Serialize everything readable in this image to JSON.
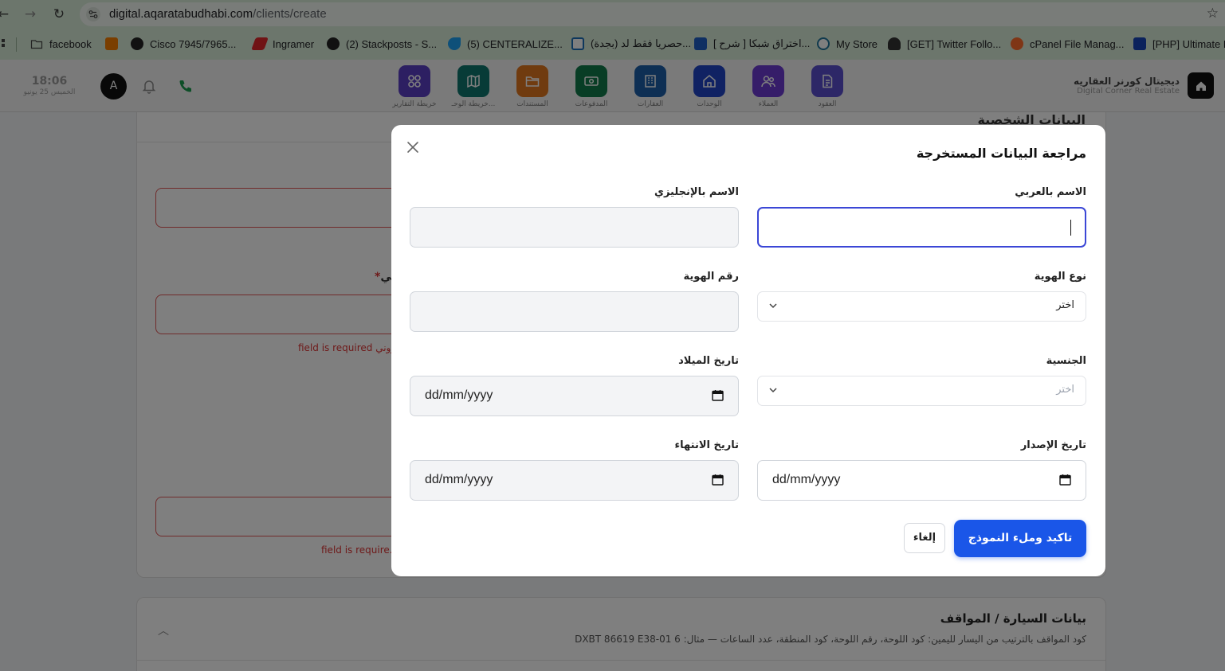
{
  "browser": {
    "url_host": "digital.aqaratabudhabi.com",
    "url_path": "/clients/create",
    "bookmarks": [
      {
        "label": "facebook",
        "icon": "folder-icon"
      },
      {
        "label": "",
        "icon": "blogger-icon"
      },
      {
        "label": "Cisco 7945/7965...",
        "icon": "globe-icon"
      },
      {
        "label": "Ingramer",
        "icon": "ingramer-icon"
      },
      {
        "label": "(2) Stackposts - S...",
        "icon": "globe-icon"
      },
      {
        "label": "(5) CENTERALIZE...",
        "icon": "bird-icon"
      },
      {
        "label": "(بجدة) حصريا فقط لد...",
        "icon": "site-icon"
      },
      {
        "label": "[ شرح ] اختراق شبكا...",
        "icon": "site-icon"
      },
      {
        "label": "My Store",
        "icon": "wordpress-icon"
      },
      {
        "label": "[GET] Twitter Follo...",
        "icon": "user-icon"
      },
      {
        "label": "cPanel File Manag...",
        "icon": "cpanel-icon"
      },
      {
        "label": "[PHP] Ultimate F",
        "icon": "s-icon"
      }
    ]
  },
  "header": {
    "time": "18:06",
    "date": "الخميس 25 يونيو",
    "avatar_letter": "A",
    "brand_ar": "ديجيتال كورنر العقاريه",
    "brand_en": "Digital Corner Real Estate",
    "modules": [
      {
        "label": "خريطة التقارير",
        "color": "#5b3fc4",
        "icon": "grid-icon"
      },
      {
        "label": "خريطة الوحـ...",
        "color": "#0f766e",
        "icon": "map-icon"
      },
      {
        "label": "المستندات",
        "color": "#e0761e",
        "icon": "folder-icon"
      },
      {
        "label": "المدفوعات",
        "color": "#107a4a",
        "icon": "money-icon"
      },
      {
        "label": "العقارات",
        "color": "#1d5fa8",
        "icon": "building-icon"
      },
      {
        "label": "الوحدات",
        "color": "#2145c7",
        "icon": "home-icon"
      },
      {
        "label": "العملاء",
        "color": "#6d3bd2",
        "icon": "users-icon"
      },
      {
        "label": "العقود",
        "color": "#5a4fcf",
        "icon": "document-icon"
      }
    ]
  },
  "background_page": {
    "section_title": "البيانات الشخصية",
    "label_fragment": "ني",
    "error_1": "field is required رّوني.",
    "error_2": "field is require.",
    "car_section_title": "بيانات السيارة / المواقف",
    "car_section_hint": "كود المواقف بالترتيب من اليسار لليمين: كود اللوحة، رقم اللوحة، كود المنطقة، عدد الساعات — مثال: DXBT 86619 E38-01 6"
  },
  "modal": {
    "title": "مراجعة البيانات المستخرجة",
    "fields": {
      "name_ar_label": "الاسم بالعربي",
      "name_ar_value": "",
      "name_en_label": "الاسم بالإنجليزي",
      "name_en_value": "",
      "id_type_label": "نوع الهوية",
      "id_type_value": "اختر",
      "id_number_label": "رقم الهوية",
      "id_number_value": "",
      "nationality_label": "الجنسية",
      "nationality_value": "اختر",
      "birth_date_label": "تاريخ الميلاد",
      "birth_date_value": "dd/mm/yyyy",
      "issue_date_label": "تاريخ الإصدار",
      "issue_date_value": "dd/mm/yyyy",
      "expiry_date_label": "تاريخ الانتهاء",
      "expiry_date_value": "dd/mm/yyyy"
    },
    "confirm_label": "تاكيد وملء النموذج",
    "cancel_label": "إلغاء"
  }
}
